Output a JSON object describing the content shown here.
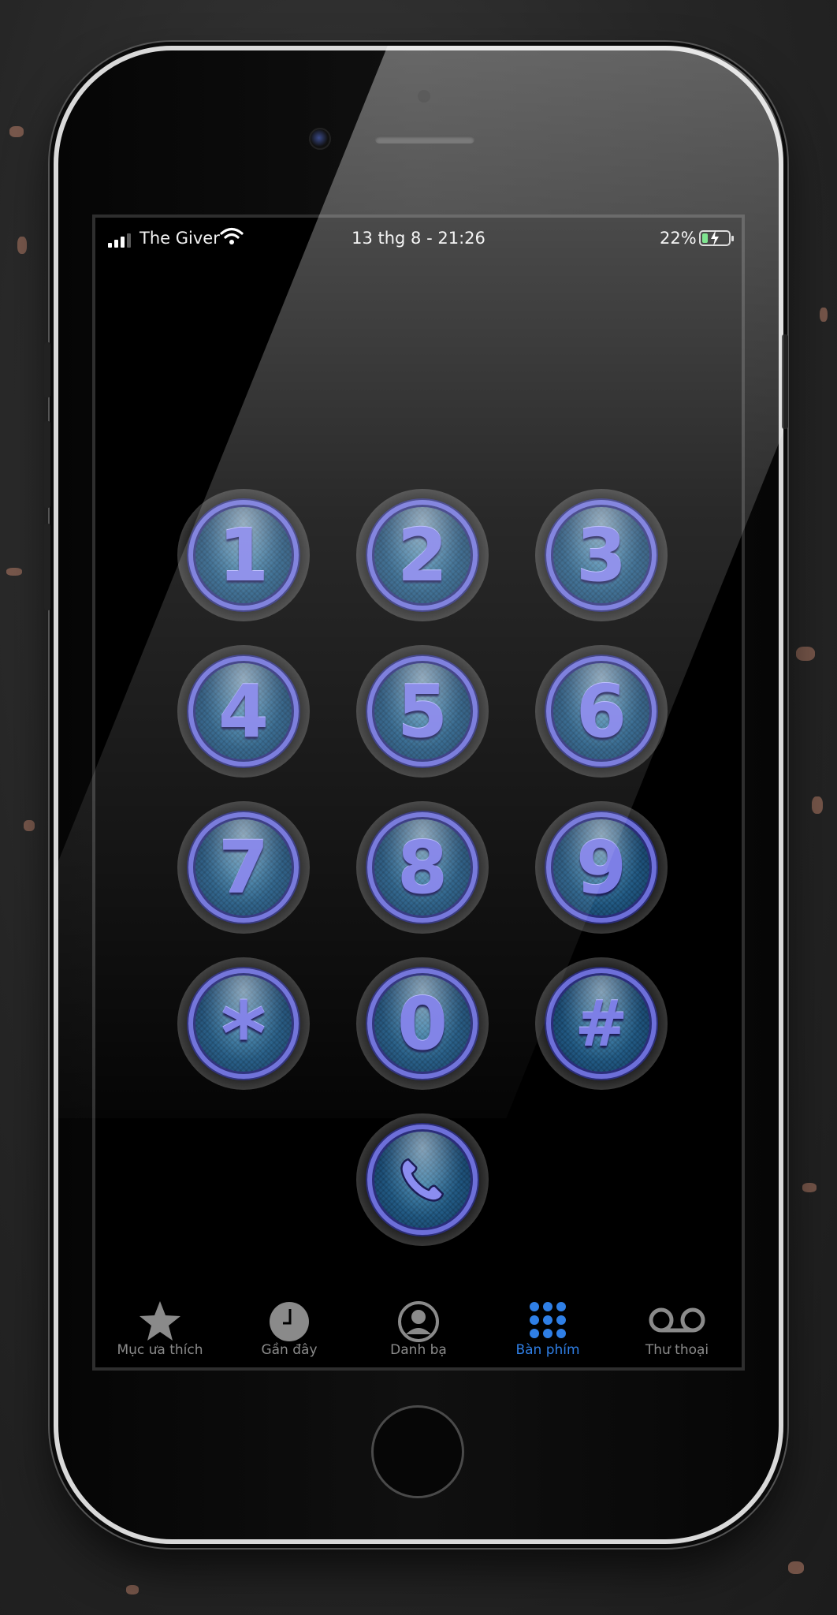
{
  "status_bar": {
    "carrier": "The Giver",
    "datetime": "13 thg 8 - 21:26",
    "battery_percent": "22%",
    "battery_level": 0.22,
    "charging": true
  },
  "keypad": {
    "keys": [
      {
        "label": "1"
      },
      {
        "label": "2"
      },
      {
        "label": "3"
      },
      {
        "label": "4"
      },
      {
        "label": "5"
      },
      {
        "label": "6"
      },
      {
        "label": "7"
      },
      {
        "label": "8"
      },
      {
        "label": "9"
      },
      {
        "label": "*"
      },
      {
        "label": "0"
      },
      {
        "label": "#"
      }
    ],
    "call_icon": "phone-handset-icon"
  },
  "tab_bar": {
    "active": "Bàn phím",
    "tabs": [
      {
        "label": "Mục ưa thích",
        "icon": "star-icon"
      },
      {
        "label": "Gần đây",
        "icon": "clock-icon"
      },
      {
        "label": "Danh bạ",
        "icon": "contact-icon"
      },
      {
        "label": "Bàn phím",
        "icon": "keypad-grid-icon"
      },
      {
        "label": "Thư thoại",
        "icon": "voicemail-icon"
      }
    ]
  },
  "colors": {
    "accent_active_tab": "#2f7fe6",
    "inactive_tab": "#8a8a8a",
    "key_ring": "#6d6fd9",
    "key_digit": "#7d7fe6",
    "battery": "#4cd964"
  }
}
